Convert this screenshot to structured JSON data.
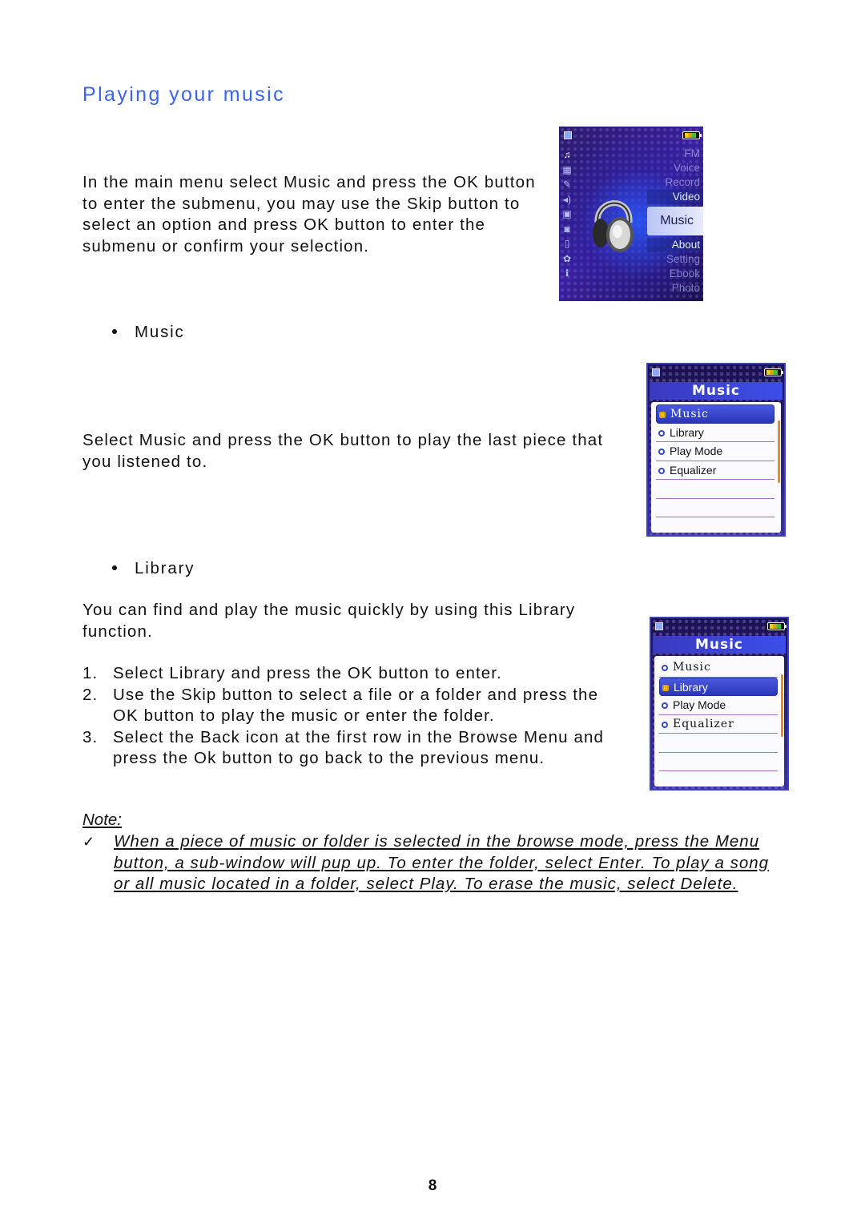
{
  "title": "Playing your music",
  "intro": "In the main menu select Music and press the OK button to enter the submenu, you may use the Skip button to select an option and press OK button to enter the submenu or confirm your selection.",
  "main_menu_screen": {
    "menu_items": [
      "FM",
      "Voice",
      "Record",
      "Video",
      "Music",
      "About",
      "Setting",
      "Ebook",
      "Photo"
    ],
    "selected": "Music",
    "side_icons": [
      "music-note-icon",
      "video-icon",
      "record-icon",
      "voice-icon",
      "fm-radio-icon",
      "photo-icon",
      "ebook-icon",
      "setting-icon",
      "about-icon"
    ]
  },
  "section_music": {
    "heading": "Music",
    "text": "Select Music and press the OK button to play the last piece that you listened to."
  },
  "music_screen_1": {
    "header": "Music",
    "items": [
      "Music",
      "Library",
      "Play Mode",
      "Equalizer"
    ],
    "selected_index": 0
  },
  "section_library": {
    "heading": "Library",
    "text": "You can find and play the music quickly by using this Library function.",
    "steps": [
      {
        "num": "1.",
        "text": "Select Library and press the OK button to enter."
      },
      {
        "num": "2.",
        "text": "Use the Skip button to select a file or a folder and press the OK button to play the music or enter the folder."
      },
      {
        "num": "3.",
        "text": "Select the Back icon at the first row in the Browse Menu and press the Ok button to go back to the previous menu."
      }
    ]
  },
  "music_screen_2": {
    "header": "Music",
    "items": [
      "Music",
      "Library",
      "Play Mode",
      "Equalizer"
    ],
    "selected_index": 1
  },
  "note": {
    "label": "Note:",
    "check": "✓",
    "text": "When a piece of music or folder is selected in the browse mode, press the Menu button, a sub-window will pup up. To enter the folder, select Enter. To play a song or all music located in a folder, select Play. To erase the music, select Delete."
  },
  "page_number": "8",
  "colors": {
    "title": "#3a63f0",
    "screen_header": "#3c4ee8",
    "selection_highlight": "#2a36b8",
    "scrollbar": "#f08a20"
  }
}
